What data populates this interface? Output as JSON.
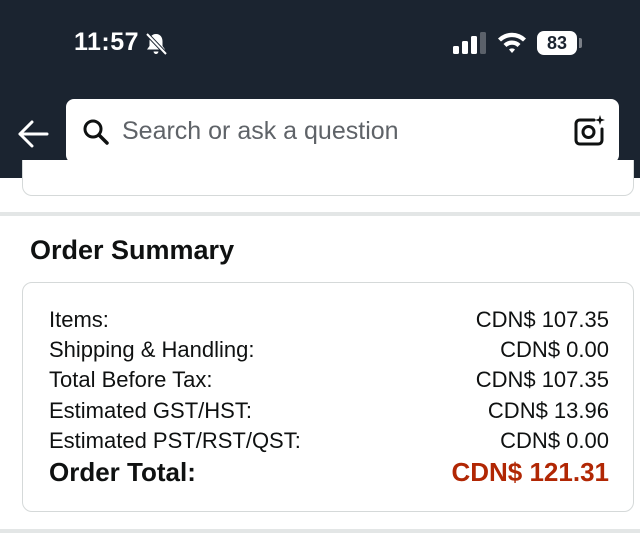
{
  "status_bar": {
    "time": "11:57",
    "battery": "83"
  },
  "search": {
    "placeholder": "Search or ask a question"
  },
  "order_summary": {
    "title": "Order Summary",
    "rows": [
      {
        "label": "Items:",
        "value": "CDN$ 107.35"
      },
      {
        "label": "Shipping & Handling:",
        "value": "CDN$ 0.00"
      },
      {
        "label": "Total Before Tax:",
        "value": "CDN$ 107.35"
      },
      {
        "label": "Estimated GST/HST:",
        "value": "CDN$ 13.96"
      },
      {
        "label": "Estimated PST/RST/QST:",
        "value": "CDN$ 0.00"
      }
    ],
    "total": {
      "label": "Order Total:",
      "value": "CDN$ 121.31"
    }
  },
  "colors": {
    "header_bg": "#1b2430",
    "total_price": "#b12704",
    "border": "#d5d9d9"
  },
  "icons": {
    "bell": "bell-slash-icon",
    "signal": "cellular-signal-icon",
    "wifi": "wifi-icon",
    "back": "back-arrow-icon",
    "search": "search-icon",
    "camera": "camera-lens-icon"
  }
}
